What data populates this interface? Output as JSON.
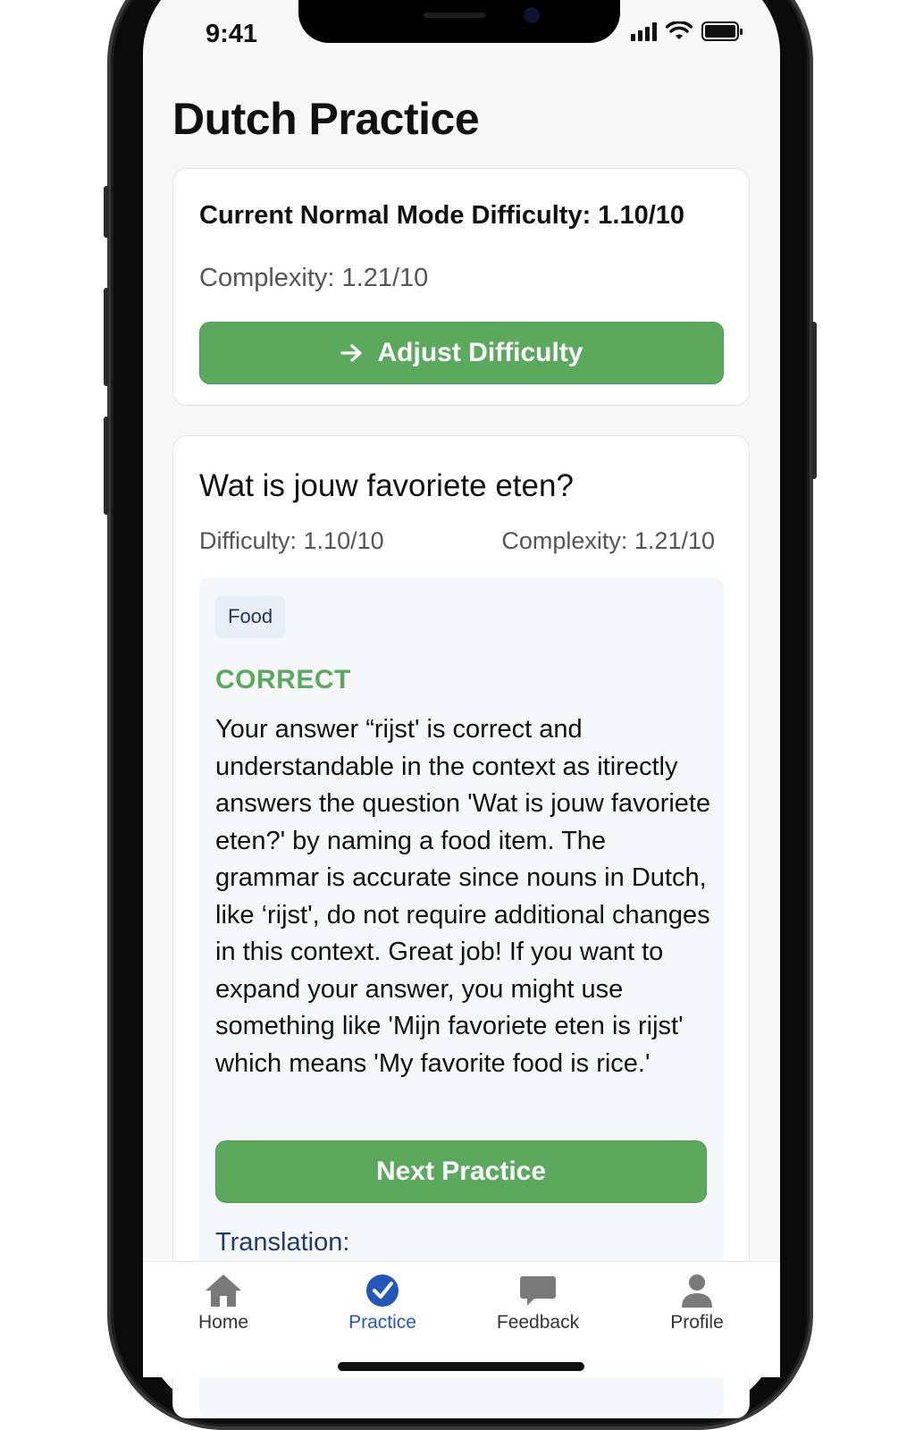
{
  "status_bar": {
    "time": "9:41"
  },
  "page": {
    "title": "Dutch Practice"
  },
  "difficulty_card": {
    "heading": "Current Normal Mode Difficulty: 1.10/10",
    "complexity": "Complexity: 1.21/10",
    "adjust_button": "Adjust Difficulty"
  },
  "question_card": {
    "question": "Wat is jouw favoriete eten?",
    "difficulty": "Difficulty: 1.10/10",
    "complexity": "Complexity: 1.21/10",
    "tag": "Food",
    "verdict": "CORRECT",
    "feedback": "Your answer “rijst' is correct and understandable in the context as itirectly answers the question 'Wat is jouw favoriete eten?' by naming a food item. The grammar is accurate since nouns in Dutch, like ‘rijst', do not require additional changes in this context. Great job! If you want to expand your answer, you might use something like 'Mijn favoriete eten is rijst' which means 'My favorite food is rice.'",
    "next_button": "Next Practice",
    "translation_label": "Translation:"
  },
  "tab_bar": {
    "items": [
      {
        "label": "Home",
        "icon": "home-icon",
        "active": false
      },
      {
        "label": "Practice",
        "icon": "check-circle-icon",
        "active": true
      },
      {
        "label": "Feedback",
        "icon": "chat-bubble-icon",
        "active": false
      },
      {
        "label": "Profile",
        "icon": "person-icon",
        "active": false
      }
    ]
  },
  "colors": {
    "accent_green": "#5aa95d",
    "active_tab_blue": "#2458b8",
    "tag_background": "#e7eef8"
  }
}
